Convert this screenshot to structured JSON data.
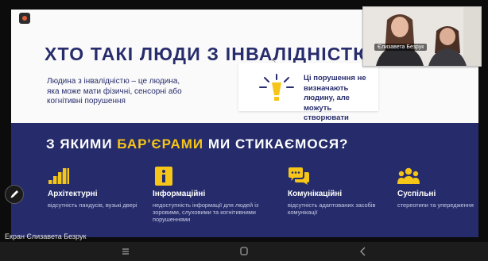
{
  "slide": {
    "title": "ХТО ТАКІ ЛЮДИ З ІНВАЛІДНІСТЮ",
    "intro": "Людина з інвалідністю – це людина, яка може мати фізичні, сенсорні або когнітивні порушення",
    "callout": "Ці порушення не визначають людину, але можуть створювати бар'єри",
    "section_title": {
      "before": "З ЯКИМИ ",
      "highlight": "БАР'ЄРАМИ",
      "after": " МИ СТИКАЄМОСЯ?"
    },
    "categories": [
      {
        "icon": "stairs-icon",
        "title": "Архітектурні",
        "desc": "відсутність пандусів, вузькі двері"
      },
      {
        "icon": "info-icon",
        "title": "Інформаційні",
        "desc": "недоступність інформації для людей із зоровими, слуховими та когнітивними порушеннями"
      },
      {
        "icon": "chat-bubbles-icon",
        "title": "Комунікаційні",
        "desc": "відсутність адаптованих засобів комунікації"
      },
      {
        "icon": "people-group-icon",
        "title": "Суспільні",
        "desc": "стереотипи та упередження"
      }
    ]
  },
  "video": {
    "participant_name": "Єлизавета Безрук"
  },
  "screen_share_label": "Екран Єлизавета Безрук",
  "colors": {
    "navy": "#272c6c",
    "slide_band": "#262c6b",
    "accent_yellow": "#f5c518"
  },
  "nav": {
    "items": [
      "recent-apps-icon",
      "home-icon",
      "back-icon"
    ]
  }
}
